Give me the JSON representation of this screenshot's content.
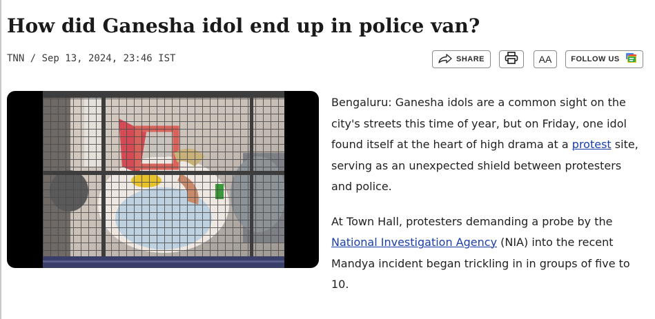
{
  "article": {
    "headline": "How did Ganesha idol end up in police van?",
    "byline": "TNN / Sep 13, 2024, 23:46 IST",
    "p1_before": "Bengaluru: Ganesha idols are a common sight on the city's streets this time of year, but on Friday, one idol found itself at the heart of high drama at a ",
    "p1_link": "protest",
    "p1_after": " site, serving as an unexpected shield between protesters and police.",
    "p2_before": "At Town Hall, protesters demanding a probe by the ",
    "p2_link": "National Investigation Agency",
    "p2_after": " (NIA) into the recent Mandya incident began trickling in in groups of five to 10."
  },
  "toolbar": {
    "share_label": "SHARE",
    "aa_label": "AA",
    "follow_label": "FOLLOW US"
  },
  "icons": {
    "share": "share-arrow-icon",
    "print": "printer-icon",
    "follow": "google-news-icon"
  },
  "colors": {
    "link": "#1a3ea8",
    "headline": "#1a1a1a",
    "border": "#8a8a8a"
  }
}
